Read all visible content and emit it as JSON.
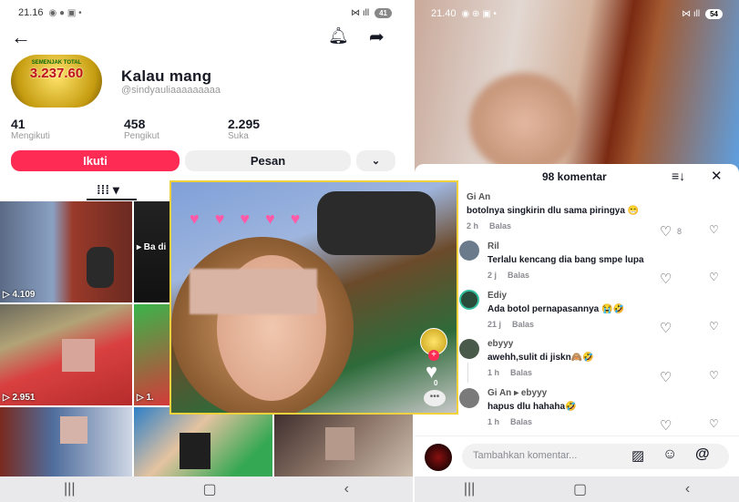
{
  "left": {
    "status": {
      "time": "21.16",
      "battery": "41"
    },
    "profile": {
      "avatar_banner": "SEMENJAK TOTAL",
      "avatar_amount": "3.237.60",
      "name": "Kalau mang",
      "handle": "@sindyauliaaaaaaaaa",
      "stats": [
        {
          "value": "41",
          "label": "Mengikuti"
        },
        {
          "value": "458",
          "label": "Pengikut"
        },
        {
          "value": "2.295",
          "label": "Suka"
        }
      ],
      "follow_label": "Ikuti",
      "message_label": "Pesan"
    },
    "videos": [
      {
        "views": "4.109"
      },
      {
        "views": "",
        "caption": "▸ Ba di"
      },
      {
        "views": "2.951"
      },
      {
        "views": "1."
      }
    ]
  },
  "overlay": {
    "like_count": "0"
  },
  "right": {
    "status": {
      "time": "21.40",
      "battery": "54"
    },
    "comments_title": "98 komentar",
    "comments": [
      {
        "user": "Gi An",
        "text": "botolnya singkirin dlu sama piringya 😁",
        "time": "2 h",
        "reply": "Balas",
        "likes": "8"
      },
      {
        "user": "Ril",
        "text": "Terlalu kencang dia bang smpe lupa",
        "time": "2 j",
        "reply": "Balas",
        "likes": ""
      },
      {
        "user": "Ediy",
        "text": "Ada botol pernapasannya 😭🤣",
        "time": "21 j",
        "reply": "Balas",
        "likes": ""
      },
      {
        "user": "ebyyy",
        "text": "awehh,sulit di jiskn🙈🤣",
        "time": "1 h",
        "reply": "Balas",
        "likes": ""
      },
      {
        "user": "Gi An ▸ ebyyy",
        "text": "hapus dlu hahaha🤣",
        "time": "1 h",
        "reply": "Balas",
        "likes": ""
      }
    ],
    "input_placeholder": "Tambahkan komentar..."
  }
}
